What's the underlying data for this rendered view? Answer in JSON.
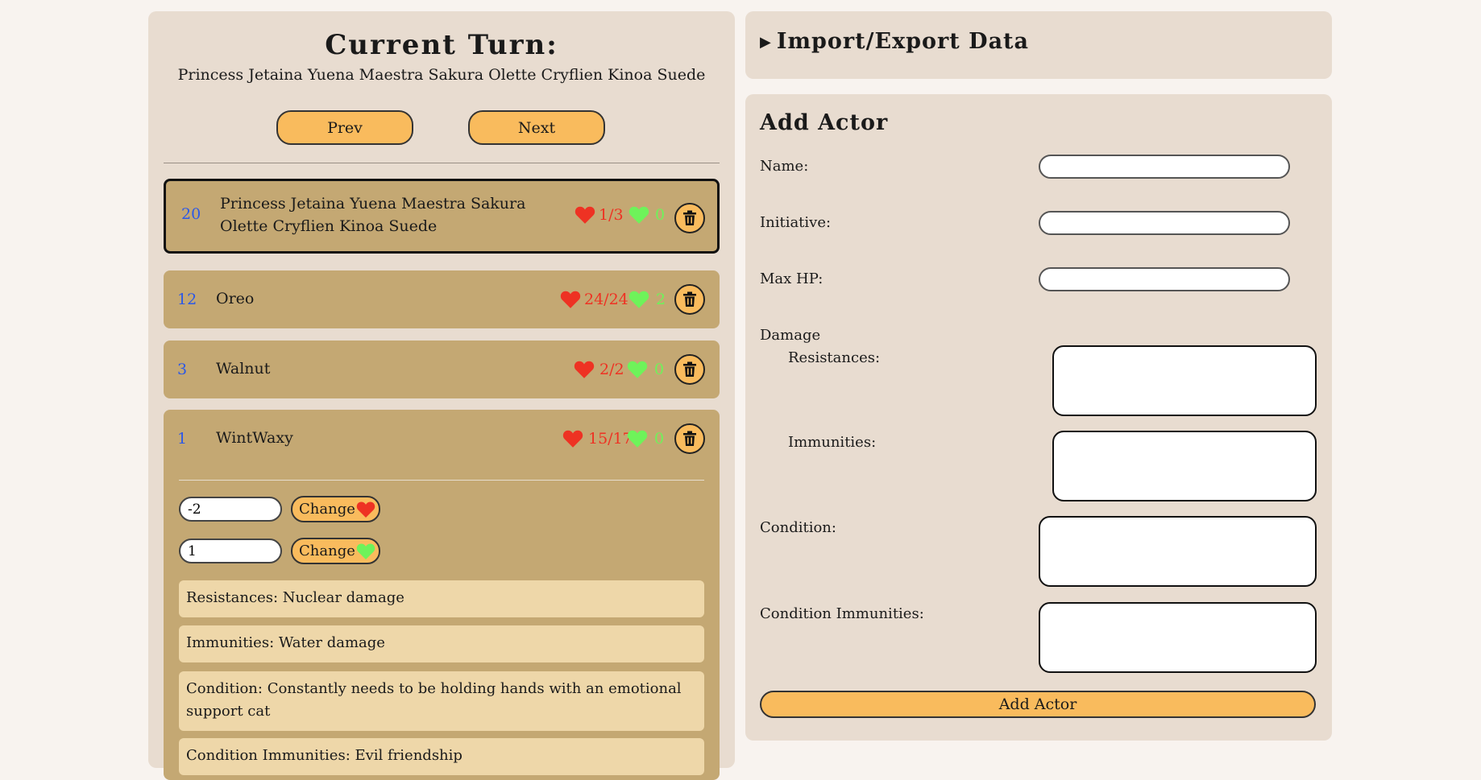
{
  "current_turn": {
    "title": "Current Turn:",
    "name": "Princess Jetaina Yuena Maestra Sakura Olette Cryflien Kinoa Suede",
    "prev_label": "Prev",
    "next_label": "Next"
  },
  "actors": [
    {
      "initiative": "20",
      "name": "Princess Jetaina Yuena Maestra Sakura Olette Cryflien Kinoa Suede",
      "hp": "1/3",
      "temp_hp": "0",
      "active": true
    },
    {
      "initiative": "12",
      "name": "Oreo",
      "hp": "24/24",
      "temp_hp": "2"
    },
    {
      "initiative": "3",
      "name": "Walnut",
      "hp": "2/2",
      "temp_hp": "0"
    },
    {
      "initiative": "1",
      "name": "WintWaxy",
      "hp": "15/17",
      "temp_hp": "0",
      "expanded": true,
      "hp_change_value": "-2",
      "temp_change_value": "1",
      "change_label": "Change",
      "resistances": "Resistances: Nuclear damage",
      "immunities": "Immunities: Water damage",
      "condition": "Condition: Constantly needs to be holding hands with an emotional support cat",
      "condition_immunities": "Condition Immunities: Evil friendship"
    }
  ],
  "import_export": {
    "label": "Import/Export Data"
  },
  "add_actor": {
    "title": "Add Actor",
    "name_label": "Name:",
    "initiative_label": "Initiative:",
    "max_hp_label": "Max HP:",
    "damage_label": "Damage",
    "resistances_label": "Resistances:",
    "immunities_label": "Immunities:",
    "condition_label": "Condition:",
    "condition_immunities_label": "Condition Immunities:",
    "button_label": "Add Actor"
  },
  "colors": {
    "page_bg": "#f8f3ef",
    "panel_bg": "#e8dcd0",
    "card_bg": "#c4a873",
    "button_bg": "#f9bb5d",
    "info_bg": "#eed7a9",
    "initiative": "#2b58e8",
    "hp": "#ee3223",
    "temp_hp": "#6ef35a"
  },
  "icons": {
    "hp": "heart-icon",
    "temp_hp": "green-heart-icon",
    "delete": "trash-icon",
    "expand": "triangle-right-icon"
  }
}
